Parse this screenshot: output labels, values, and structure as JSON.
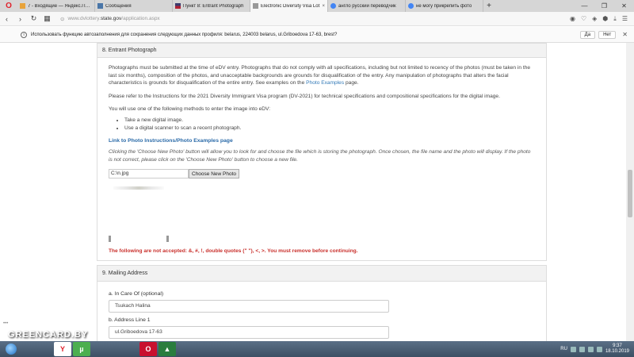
{
  "browser": {
    "tabs": [
      {
        "title": "7 - Входящие — Яндекс.Почта",
        "active": false
      },
      {
        "title": "Сообщения",
        "active": false
      },
      {
        "title": "Пункт 8: Entrant Photograph",
        "active": false
      },
      {
        "title": "Electronic Diversity Visa Lot",
        "active": true
      },
      {
        "title": "англо русский переводчик",
        "active": false
      },
      {
        "title": "не могу прикрепить фото",
        "active": false
      }
    ],
    "url": {
      "prefix": "www.dvlottery.",
      "host": "state.gov",
      "path": "/application.aspx"
    },
    "autofill_prompt": {
      "message": "Использовать функцию автозаполнения для сохранения следующих данных профиля: belarus, 224003 belarus, ul.Griboedova 17-63, brest?",
      "yes_label": "Да",
      "no_label": "Нет"
    }
  },
  "photo_section": {
    "header": "8. Entrant Photograph",
    "para1": "Photographs must be submitted at the time of eDV entry. Photographs that do not comply with all specifications, including but not limited to recency of the photos (must be taken in the last six months), composition of the photos, and unacceptable backgrounds are grounds for disqualification of the entry. Any manipulation of photographs that alters the facial characteristics is grounds for disqualification of the entire entry. See examples on the",
    "para1_link": "Photo Examples",
    "para1_end": "page.",
    "para2": "Please refer to the Instructions for the 2021 Diversity Immigrant Visa program (DV-2021) for technical specifications and compositional specifications for the digital image.",
    "para3": "You will use one of the following methods to enter the image into eDV:",
    "methods": [
      "Take a new digital image.",
      "Use a digital scanner to scan a recent photograph."
    ],
    "instructions_link": "Link to Photo Instructions/Photo Examples page",
    "choose_help": "Clicking the 'Choose New Photo' button will allow you to look for and choose the file which is storing the photograph. Once chosen, the file name and the photo will display. If the photo is not correct, please click on the 'Choose New Photo' button to choose a new file.",
    "file_value": "C:\\n.jpg",
    "choose_button": "Choose New Photo",
    "warning": "The following are not accepted: &, #, !, double quotes (\" \"), <, >. You must remove before continuing."
  },
  "mailing_section": {
    "header": "9. Mailing Address",
    "in_care_label": "a. In Care Of (optional)",
    "in_care_value": "Tsukach Halina",
    "address1_label": "b. Address Line 1",
    "address1_value": "ul.Griboedova 17-63"
  },
  "taskbar": {
    "watermark": "GREENCARD.BY",
    "lang": "RU",
    "time": "9:37",
    "date": "18.10.2019"
  }
}
